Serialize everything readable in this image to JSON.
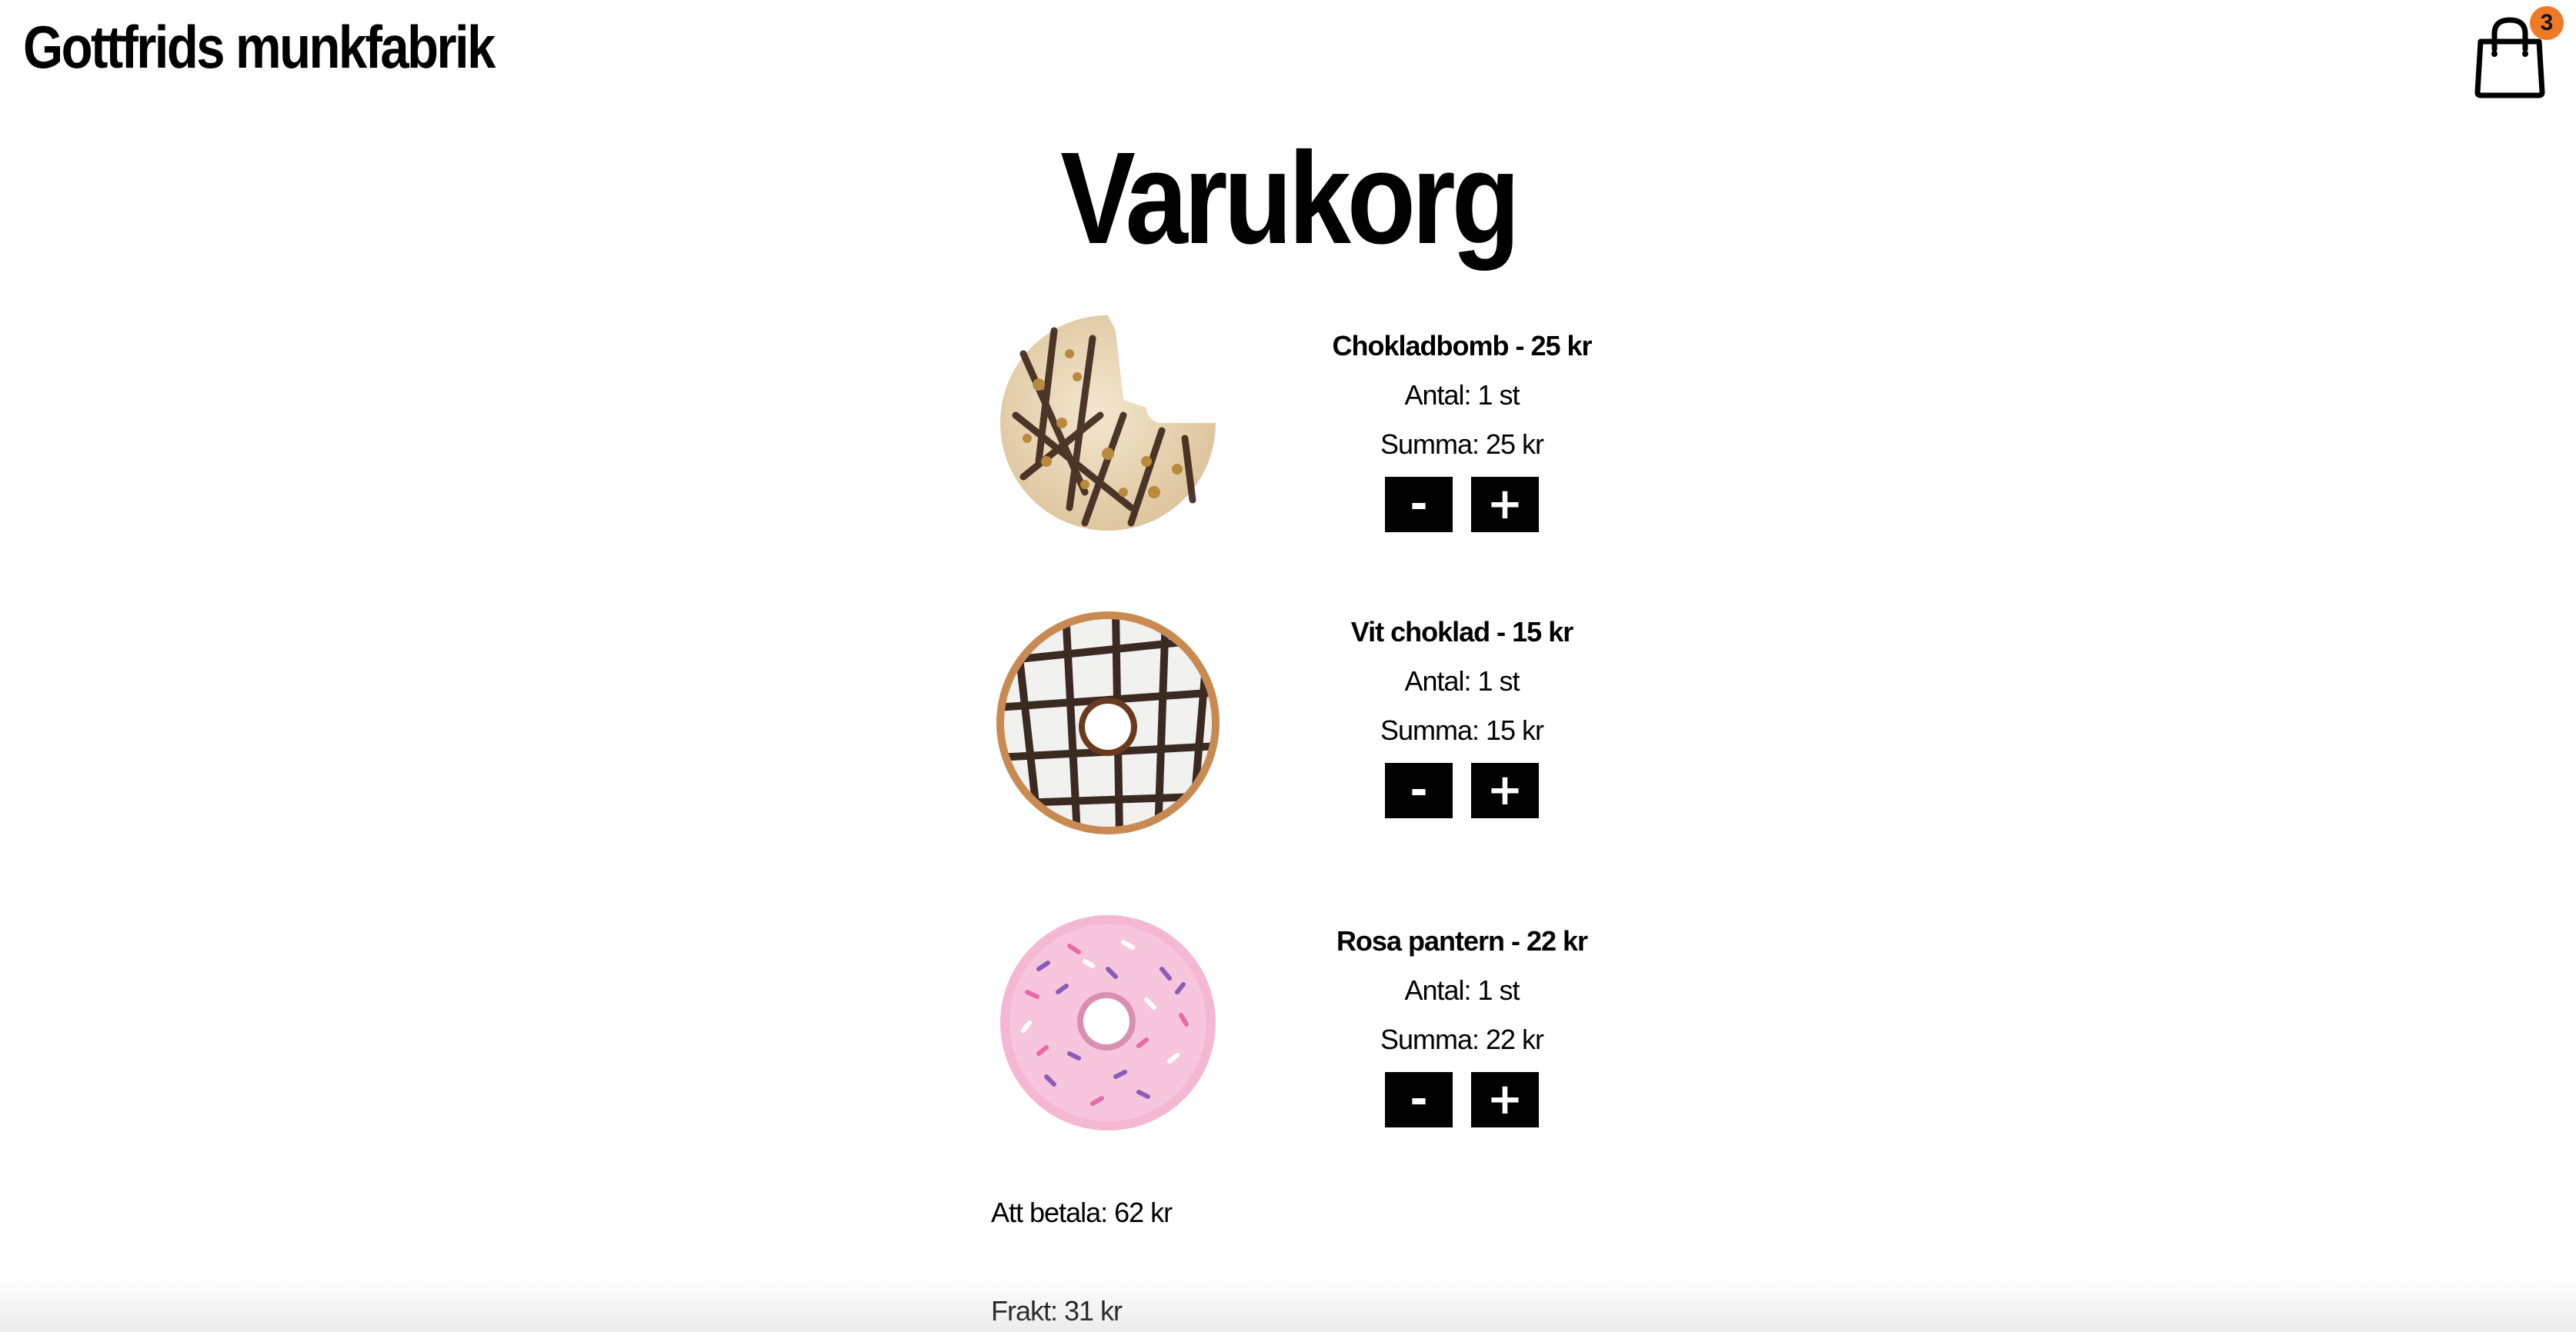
{
  "header": {
    "brand": "Gottfrids munkfabrik",
    "cart_count": "3"
  },
  "page_title": "Varukorg",
  "items": [
    {
      "title": "Chokladbomb - 25 kr",
      "quantity": "Antal: 1 st",
      "sum": "Summa: 25 kr",
      "minus_label": "-",
      "plus_label": "+"
    },
    {
      "title": "Vit choklad - 15 kr",
      "quantity": "Antal: 1 st",
      "sum": "Summa: 15 kr",
      "minus_label": "-",
      "plus_label": "+"
    },
    {
      "title": "Rosa pantern - 22 kr",
      "quantity": "Antal: 1 st",
      "sum": "Summa: 22 kr",
      "minus_label": "-",
      "plus_label": "+"
    }
  ],
  "summary": {
    "to_pay": "Att betala: 62 kr",
    "shipping": "Frakt: 31 kr"
  },
  "colors": {
    "badge": "#f07a23",
    "button_bg": "#000000",
    "button_text": "#ffffff"
  }
}
